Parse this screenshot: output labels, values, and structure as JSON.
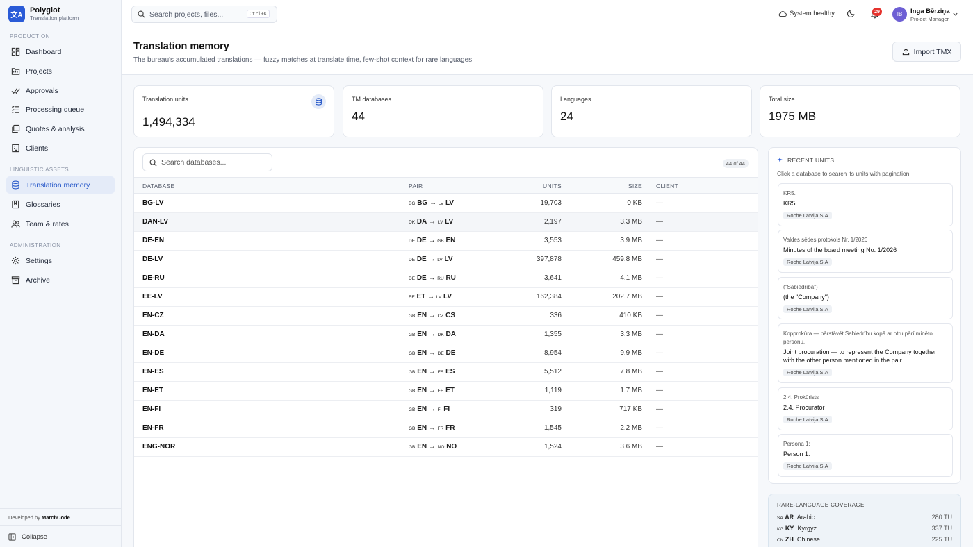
{
  "app": {
    "name": "Polyglot",
    "subtitle": "Translation platform",
    "logo": "文A"
  },
  "sidebar": {
    "sections": [
      "PRODUCTION",
      "LINGUISTIC ASSETS",
      "ADMINISTRATION"
    ],
    "items": [
      {
        "label": "Dashboard",
        "icon": "dashboard-icon"
      },
      {
        "label": "Projects",
        "icon": "folder-icon"
      },
      {
        "label": "Approvals",
        "icon": "check-icon"
      },
      {
        "label": "Processing queue",
        "icon": "queue-icon"
      },
      {
        "label": "Quotes & analysis",
        "icon": "quote-icon"
      },
      {
        "label": "Clients",
        "icon": "building-icon"
      },
      {
        "label": "Translation memory",
        "icon": "database-icon",
        "active": true
      },
      {
        "label": "Glossaries",
        "icon": "book-icon"
      },
      {
        "label": "Team & rates",
        "icon": "users-icon"
      },
      {
        "label": "Settings",
        "icon": "gear-icon"
      },
      {
        "label": "Archive",
        "icon": "archive-icon"
      }
    ],
    "developed_by": "Developed by",
    "developer": "MarchCode",
    "collapse": "Collapse"
  },
  "topbar": {
    "search_placeholder": "Search projects, files...",
    "shortcut": "Ctrl+K",
    "status": "System healthy",
    "notifications": "29",
    "user_initials": "IB",
    "user_name": "Inga Bērziņa",
    "user_role": "Project Manager"
  },
  "page": {
    "title": "Translation memory",
    "subtitle": "The bureau's accumulated translations — fuzzy matches at translate time, few-shot context for rare languages.",
    "import_label": "Import TMX"
  },
  "stats": [
    {
      "label": "Translation units",
      "value": "1,494,334"
    },
    {
      "label": "TM databases",
      "value": "44"
    },
    {
      "label": "Languages",
      "value": "24"
    },
    {
      "label": "Total size",
      "value": "1975 MB"
    }
  ],
  "table": {
    "search_placeholder": "Search databases...",
    "count": "44 of 44",
    "headers": [
      "DATABASE",
      "PAIR",
      "UNITS",
      "SIZE",
      "CLIENT"
    ],
    "rows": [
      {
        "db": "BG-LV",
        "sc": "BG",
        "s": "BG",
        "tc": "LV",
        "t": "LV",
        "units": "19,703",
        "size": "0 KB",
        "client": "—"
      },
      {
        "db": "DAN-LV",
        "sc": "DK",
        "s": "DA",
        "tc": "LV",
        "t": "LV",
        "units": "2,197",
        "size": "3.3 MB",
        "client": "—"
      },
      {
        "db": "DE-EN",
        "sc": "DE",
        "s": "DE",
        "tc": "GB",
        "t": "EN",
        "units": "3,553",
        "size": "3.9 MB",
        "client": "—"
      },
      {
        "db": "DE-LV",
        "sc": "DE",
        "s": "DE",
        "tc": "LV",
        "t": "LV",
        "units": "397,878",
        "size": "459.8 MB",
        "client": "—"
      },
      {
        "db": "DE-RU",
        "sc": "DE",
        "s": "DE",
        "tc": "RU",
        "t": "RU",
        "units": "3,641",
        "size": "4.1 MB",
        "client": "—"
      },
      {
        "db": "EE-LV",
        "sc": "EE",
        "s": "ET",
        "tc": "LV",
        "t": "LV",
        "units": "162,384",
        "size": "202.7 MB",
        "client": "—"
      },
      {
        "db": "EN-CZ",
        "sc": "GB",
        "s": "EN",
        "tc": "CZ",
        "t": "CS",
        "units": "336",
        "size": "410 KB",
        "client": "—"
      },
      {
        "db": "EN-DA",
        "sc": "GB",
        "s": "EN",
        "tc": "DK",
        "t": "DA",
        "units": "1,355",
        "size": "3.3 MB",
        "client": "—"
      },
      {
        "db": "EN-DE",
        "sc": "GB",
        "s": "EN",
        "tc": "DE",
        "t": "DE",
        "units": "8,954",
        "size": "9.9 MB",
        "client": "—"
      },
      {
        "db": "EN-ES",
        "sc": "GB",
        "s": "EN",
        "tc": "ES",
        "t": "ES",
        "units": "5,512",
        "size": "7.8 MB",
        "client": "—"
      },
      {
        "db": "EN-ET",
        "sc": "GB",
        "s": "EN",
        "tc": "EE",
        "t": "ET",
        "units": "1,119",
        "size": "1.7 MB",
        "client": "—"
      },
      {
        "db": "EN-FI",
        "sc": "GB",
        "s": "EN",
        "tc": "FI",
        "t": "FI",
        "units": "319",
        "size": "717 KB",
        "client": "—"
      },
      {
        "db": "EN-FR",
        "sc": "GB",
        "s": "EN",
        "tc": "FR",
        "t": "FR",
        "units": "1,545",
        "size": "2.2 MB",
        "client": "—"
      },
      {
        "db": "ENG-NOR",
        "sc": "GB",
        "s": "EN",
        "tc": "NO",
        "t": "NO",
        "units": "1,524",
        "size": "3.6 MB",
        "client": "—"
      }
    ]
  },
  "recent": {
    "title": "RECENT UNITS",
    "subtitle": "Click a database to search its units with pagination.",
    "units": [
      {
        "src": "KR5.",
        "tgt": "KR5.",
        "client": "Roche Latvija SIA"
      },
      {
        "src": "Valdes sēdes protokols Nr. 1/2026",
        "tgt": "Minutes of the board meeting No. 1/2026",
        "client": "Roche Latvija SIA"
      },
      {
        "src": "(\"Sabiedrība\")",
        "tgt": "(the \"Company\")",
        "client": "Roche Latvija SIA"
      },
      {
        "src": "Kopprokūra — pārstāvēt Sabiedrību kopā ar otru pārī minēto personu.",
        "tgt": "Joint procuration — to represent the Company together with the other person mentioned in the pair.",
        "client": "Roche Latvija SIA"
      },
      {
        "src": "2.4. Prokūrists",
        "tgt": "2.4. Procurator",
        "client": "Roche Latvija SIA"
      },
      {
        "src": "Persona 1:",
        "tgt": "Person 1:",
        "client": "Roche Latvija SIA"
      }
    ]
  },
  "rare": {
    "title": "RARE-LANGUAGE COVERAGE",
    "items": [
      {
        "cc": "SA",
        "code": "AR",
        "name": "Arabic",
        "tu": "280 TU"
      },
      {
        "cc": "KG",
        "code": "KY",
        "name": "Kyrgyz",
        "tu": "337 TU"
      },
      {
        "cc": "CN",
        "code": "ZH",
        "name": "Chinese",
        "tu": "225 TU"
      }
    ]
  },
  "colors": {
    "accent": "#2a5bd7",
    "badge": "#e5322d",
    "active_bg": "#e4ebf8"
  }
}
